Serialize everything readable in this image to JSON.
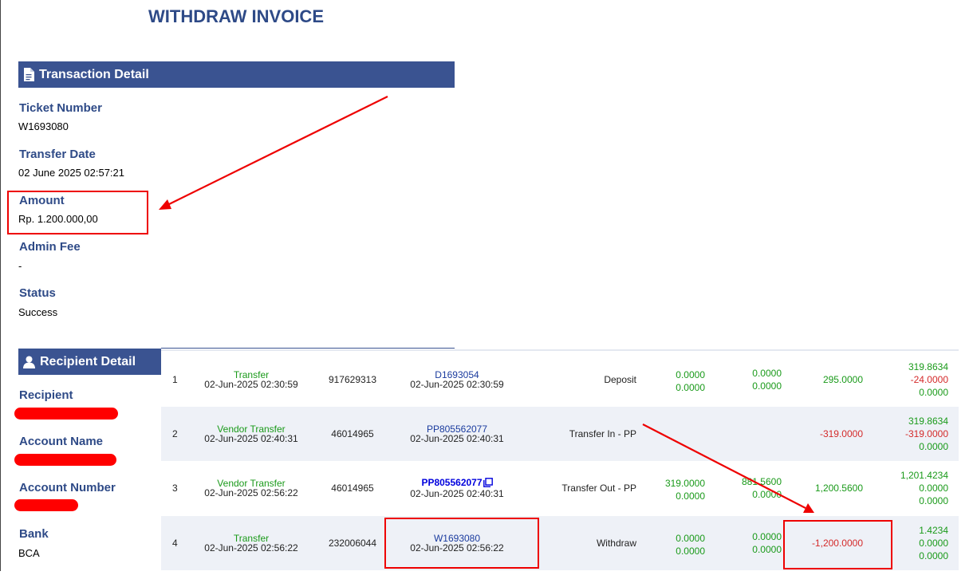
{
  "page_title": "WITHDRAW INVOICE",
  "transaction": {
    "header": "Transaction Detail",
    "header_icon": "document-icon",
    "fields": [
      {
        "label": "Ticket Number",
        "value": "W1693080"
      },
      {
        "label": "Transfer Date",
        "value": "02 June 2025 02:57:21"
      },
      {
        "label": "Amount",
        "value": "Rp. 1.200.000,00"
      },
      {
        "label": "Admin Fee",
        "value": "-"
      },
      {
        "label": "Status",
        "value": "Success"
      }
    ]
  },
  "recipient": {
    "header": "Recipient Detail",
    "header_icon": "user-icon",
    "fields": [
      {
        "label": "Recipient",
        "value": ""
      },
      {
        "label": "Account Name",
        "value": ""
      },
      {
        "label": "Account Number",
        "value": ""
      },
      {
        "label": "Bank",
        "value": "BCA"
      }
    ]
  },
  "ledger": {
    "rows": [
      {
        "no": "1",
        "type": "Transfer",
        "type_time": "02-Jun-2025 02:30:59",
        "ref_no": "917629313",
        "ref_id": "D1693054",
        "ref_time": "02-Jun-2025 02:30:59",
        "desc": "Deposit",
        "col_a": [
          "0.0000",
          "0.0000"
        ],
        "col_b": [
          "0.0000",
          "0.0000"
        ],
        "amount": "295.0000",
        "balance": [
          "319.8634",
          "-24.0000",
          "0.0000"
        ]
      },
      {
        "no": "2",
        "type": "Vendor Transfer",
        "type_time": "02-Jun-2025 02:40:31",
        "ref_no": "46014965",
        "ref_id": "PP805562077",
        "ref_time": "02-Jun-2025 02:40:31",
        "desc": "Transfer In - PP",
        "col_a": [
          "",
          ""
        ],
        "col_b": [
          "",
          ""
        ],
        "amount": "-319.0000",
        "balance": [
          "319.8634",
          "-319.0000",
          "0.0000"
        ]
      },
      {
        "no": "3",
        "type": "Vendor Transfer",
        "type_time": "02-Jun-2025 02:56:22",
        "ref_no": "46014965",
        "ref_id": "PP805562077",
        "ref_time": "02-Jun-2025 02:40:31",
        "desc": "Transfer Out - PP",
        "col_a": [
          "319.0000",
          "0.0000"
        ],
        "col_b": [
          "881.5600",
          "0.0000"
        ],
        "amount": "1,200.5600",
        "balance": [
          "1,201.4234",
          "0.0000",
          "0.0000"
        ]
      },
      {
        "no": "4",
        "type": "Transfer",
        "type_time": "02-Jun-2025 02:56:22",
        "ref_no": "232006044",
        "ref_id": "W1693080",
        "ref_time": "02-Jun-2025 02:56:22",
        "desc": "Withdraw",
        "col_a": [
          "0.0000",
          "0.0000"
        ],
        "col_b": [
          "0.0000",
          "0.0000"
        ],
        "amount": "-1,200.0000",
        "balance": [
          "1.4234",
          "0.0000",
          "0.0000"
        ]
      }
    ]
  },
  "colors": {
    "header_bg": "#3a5391",
    "label": "#2e4a87",
    "green": "#1a9a1a",
    "red": "#d42a2a",
    "annotation": "#ee0000"
  }
}
